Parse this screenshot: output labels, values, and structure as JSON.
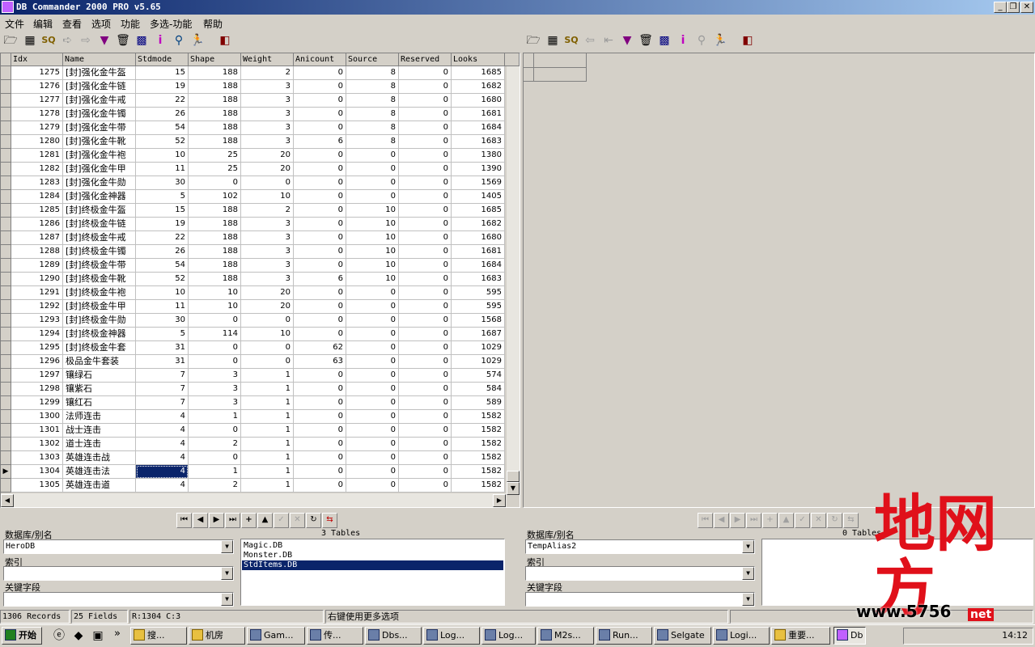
{
  "window": {
    "title": "DB Commander 2000 PRO v5.65"
  },
  "menu": [
    "文件",
    "编辑",
    "查看",
    "选项",
    "功能",
    "多选-功能",
    "帮助"
  ],
  "grid": {
    "columns": [
      "Idx",
      "Name",
      "Stdmode",
      "Shape",
      "Weight",
      "Anicount",
      "Source",
      "Reserved",
      "Looks"
    ],
    "rows": [
      [
        "1275",
        "[封]强化金牛盔",
        "15",
        "188",
        "2",
        "0",
        "8",
        "0",
        "1685"
      ],
      [
        "1276",
        "[封]强化金牛链",
        "19",
        "188",
        "3",
        "0",
        "8",
        "0",
        "1682"
      ],
      [
        "1277",
        "[封]强化金牛戒",
        "22",
        "188",
        "3",
        "0",
        "8",
        "0",
        "1680"
      ],
      [
        "1278",
        "[封]强化金牛镯",
        "26",
        "188",
        "3",
        "0",
        "8",
        "0",
        "1681"
      ],
      [
        "1279",
        "[封]强化金牛带",
        "54",
        "188",
        "3",
        "0",
        "8",
        "0",
        "1684"
      ],
      [
        "1280",
        "[封]强化金牛靴",
        "52",
        "188",
        "3",
        "6",
        "8",
        "0",
        "1683"
      ],
      [
        "1281",
        "[封]强化金牛袍",
        "10",
        "25",
        "20",
        "0",
        "0",
        "0",
        "1380"
      ],
      [
        "1282",
        "[封]强化金牛甲",
        "11",
        "25",
        "20",
        "0",
        "0",
        "0",
        "1390"
      ],
      [
        "1283",
        "[封]强化金牛勋",
        "30",
        "0",
        "0",
        "0",
        "0",
        "0",
        "1569"
      ],
      [
        "1284",
        "[封]强化金神器",
        "5",
        "102",
        "10",
        "0",
        "0",
        "0",
        "1405"
      ],
      [
        "1285",
        "[封]终极金牛盔",
        "15",
        "188",
        "2",
        "0",
        "10",
        "0",
        "1685"
      ],
      [
        "1286",
        "[封]终极金牛链",
        "19",
        "188",
        "3",
        "0",
        "10",
        "0",
        "1682"
      ],
      [
        "1287",
        "[封]终极金牛戒",
        "22",
        "188",
        "3",
        "0",
        "10",
        "0",
        "1680"
      ],
      [
        "1288",
        "[封]终极金牛镯",
        "26",
        "188",
        "3",
        "0",
        "10",
        "0",
        "1681"
      ],
      [
        "1289",
        "[封]终极金牛带",
        "54",
        "188",
        "3",
        "0",
        "10",
        "0",
        "1684"
      ],
      [
        "1290",
        "[封]终极金牛靴",
        "52",
        "188",
        "3",
        "6",
        "10",
        "0",
        "1683"
      ],
      [
        "1291",
        "[封]终极金牛袍",
        "10",
        "10",
        "20",
        "0",
        "0",
        "0",
        "595"
      ],
      [
        "1292",
        "[封]终极金牛甲",
        "11",
        "10",
        "20",
        "0",
        "0",
        "0",
        "595"
      ],
      [
        "1293",
        "[封]终极金牛勋",
        "30",
        "0",
        "0",
        "0",
        "0",
        "0",
        "1568"
      ],
      [
        "1294",
        "[封]终极金神器",
        "5",
        "114",
        "10",
        "0",
        "0",
        "0",
        "1687"
      ],
      [
        "1295",
        "[封]终极金牛套",
        "31",
        "0",
        "0",
        "62",
        "0",
        "0",
        "1029"
      ],
      [
        "1296",
        "极品金牛套装",
        "31",
        "0",
        "0",
        "63",
        "0",
        "0",
        "1029"
      ],
      [
        "1297",
        "镶绿石",
        "7",
        "3",
        "1",
        "0",
        "0",
        "0",
        "574"
      ],
      [
        "1298",
        "镶紫石",
        "7",
        "3",
        "1",
        "0",
        "0",
        "0",
        "584"
      ],
      [
        "1299",
        "镶红石",
        "7",
        "3",
        "1",
        "0",
        "0",
        "0",
        "589"
      ],
      [
        "1300",
        "法师连击",
        "4",
        "1",
        "1",
        "0",
        "0",
        "0",
        "1582"
      ],
      [
        "1301",
        "战士连击",
        "4",
        "0",
        "1",
        "0",
        "0",
        "0",
        "1582"
      ],
      [
        "1302",
        "道士连击",
        "4",
        "2",
        "1",
        "0",
        "0",
        "0",
        "1582"
      ],
      [
        "1303",
        "英雄连击战",
        "4",
        "0",
        "1",
        "0",
        "0",
        "0",
        "1582"
      ],
      [
        "1304",
        "英雄连击法",
        "4",
        "1",
        "1",
        "0",
        "0",
        "0",
        "1582"
      ],
      [
        "1305",
        "英雄连击道",
        "4",
        "2",
        "1",
        "0",
        "0",
        "0",
        "1582"
      ]
    ],
    "selected_row_index": 29
  },
  "left_panel": {
    "db_label": "数据库/别名",
    "db_value": "HeroDB",
    "index_label": "索引",
    "key_label": "关键字段",
    "tables_count": "3 Tables",
    "tables": [
      "Magic.DB",
      "Monster.DB",
      "StdItems.DB"
    ],
    "selected_table_index": 2
  },
  "right_panel": {
    "db_label": "数据库/别名",
    "db_value": "TempAlias2",
    "index_label": "索引",
    "key_label": "关键字段",
    "tables_count": "0 Tables"
  },
  "status": {
    "records": "1306 Records",
    "fields": "25 Fields",
    "position": "R:1304 C:3",
    "hint": "右键使用更多选项"
  },
  "taskbar": {
    "start": "开始",
    "tasks": [
      "搜...",
      "机房",
      "Gam...",
      "传...",
      "Dbs...",
      "Log...",
      "Log...",
      "M2s...",
      "Run...",
      "Selgate",
      "Logi...",
      "重要..."
    ],
    "clock": "14:12"
  },
  "watermark": {
    "chars": "地网方",
    "url": "www.5756",
    "suffix": "net"
  },
  "colors": {
    "selection": "#0a246a",
    "face": "#d4d0c8",
    "watermark": "#e0101a"
  }
}
